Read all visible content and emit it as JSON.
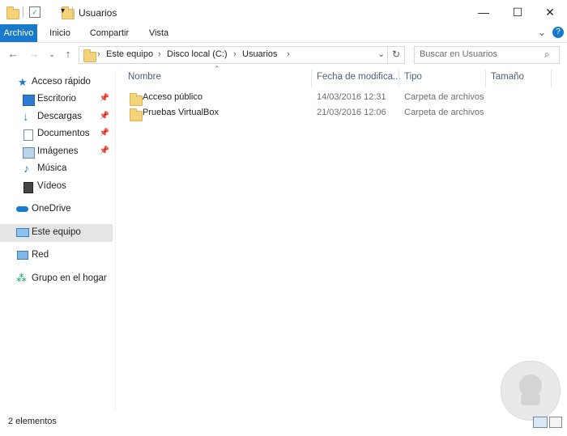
{
  "window": {
    "title": "Usuarios",
    "minimize": "—",
    "maximize": "☐",
    "close": "✕"
  },
  "ribbon": {
    "tabs": [
      "Archivo",
      "Inicio",
      "Compartir",
      "Vista"
    ],
    "help": "?",
    "expand": "⌄"
  },
  "address": {
    "crumbs": [
      "Este equipo",
      "Disco local (C:)",
      "Usuarios"
    ],
    "separator": "›"
  },
  "search": {
    "placeholder": "Buscar en Usuarios"
  },
  "navpane": {
    "quick_access": "Acceso rápido",
    "quick_items": [
      "Escritorio",
      "Descargas",
      "Documentos",
      "Imágenes",
      "Música",
      "Vídeos"
    ],
    "onedrive": "OneDrive",
    "this_pc": "Este equipo",
    "network": "Red",
    "homegroup": "Grupo en el hogar"
  },
  "columns": [
    "Nombre",
    "Fecha de modifica...",
    "Tipo",
    "Tamaño"
  ],
  "rows": [
    {
      "name": "Acceso público",
      "date": "14/03/2016 12:31",
      "type": "Carpeta de archivos"
    },
    {
      "name": "Pruebas VirtualBox",
      "date": "21/03/2016 12:06",
      "type": "Carpeta de archivos"
    }
  ],
  "status": {
    "count": "2 elementos"
  },
  "colors": {
    "accent": "#1979ca",
    "selected": "#e5e5e5",
    "folder": "#f3d27a"
  }
}
